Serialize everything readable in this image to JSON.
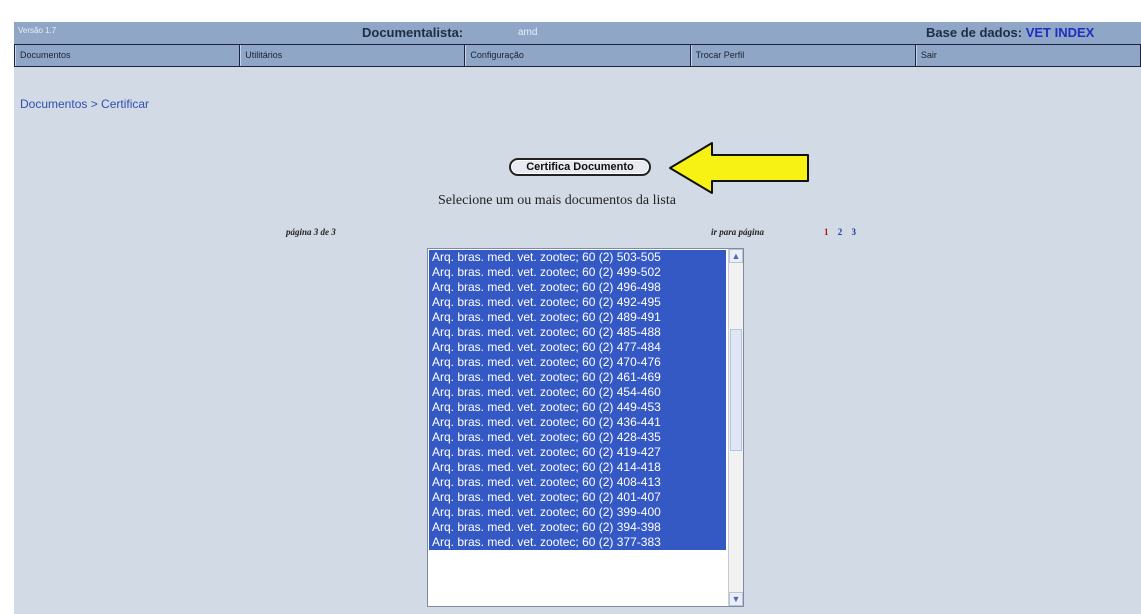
{
  "header": {
    "version": "Versão 1.7",
    "documentalist_label": "Documentalista:",
    "documentalist_user": "amd",
    "database_label": "Base de dados:",
    "database_name": "VET INDEX"
  },
  "menu": {
    "items": [
      {
        "label": "Documentos"
      },
      {
        "label": "Utilitários"
      },
      {
        "label": "Configuração"
      },
      {
        "label": "Trocar Perfil"
      },
      {
        "label": "Sair"
      }
    ]
  },
  "breadcrumb": "Documentos > Certificar",
  "actions": {
    "certify_label": "Certifica Documento"
  },
  "instruction": "Selecione um ou mais documentos da lista",
  "pagination": {
    "page_info": "página 3 de 3",
    "goto_label": "ir para página",
    "pages": [
      "1",
      "2",
      "3"
    ],
    "current_page": "1"
  },
  "documents": [
    "Arq. bras. med. vet. zootec; 60 (2) 503-505",
    "Arq. bras. med. vet. zootec; 60 (2) 499-502",
    "Arq. bras. med. vet. zootec; 60 (2) 496-498",
    "Arq. bras. med. vet. zootec; 60 (2) 492-495",
    "Arq. bras. med. vet. zootec; 60 (2) 489-491",
    "Arq. bras. med. vet. zootec; 60 (2) 485-488",
    "Arq. bras. med. vet. zootec; 60 (2) 477-484",
    "Arq. bras. med. vet. zootec; 60 (2) 470-476",
    "Arq. bras. med. vet. zootec; 60 (2) 461-469",
    "Arq. bras. med. vet. zootec; 60 (2) 454-460",
    "Arq. bras. med. vet. zootec; 60 (2) 449-453",
    "Arq. bras. med. vet. zootec; 60 (2) 436-441",
    "Arq. bras. med. vet. zootec; 60 (2) 428-435",
    "Arq. bras. med. vet. zootec; 60 (2) 419-427",
    "Arq. bras. med. vet. zootec; 60 (2) 414-418",
    "Arq. bras. med. vet. zootec; 60 (2) 408-413",
    "Arq. bras. med. vet. zootec; 60 (2) 401-407",
    "Arq. bras. med. vet. zootec; 60 (2) 399-400",
    "Arq. bras. med. vet. zootec; 60 (2) 394-398",
    "Arq. bras. med. vet. zootec; 60 (2) 377-383"
  ],
  "icons": {
    "arrow": "yellow-left-arrow-icon",
    "scroll_up": "chevron-up-icon",
    "scroll_down": "chevron-down-icon"
  },
  "colors": {
    "background": "#d2dae6",
    "header": "#8fa6c6",
    "selection": "#3559c4",
    "arrow": "#f7f214"
  }
}
